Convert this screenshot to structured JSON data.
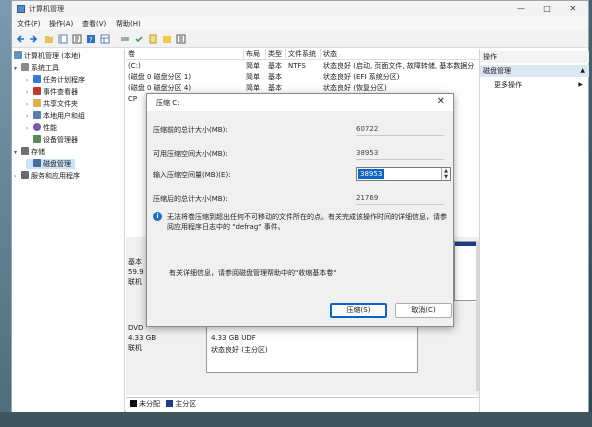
{
  "window": {
    "title": "计算机管理",
    "min": "—",
    "max": "□",
    "close": "✕"
  },
  "menu": [
    "文件(F)",
    "操作(A)",
    "查看(V)",
    "帮助(H)"
  ],
  "tree": [
    {
      "label": "计算机管理 (本地)",
      "indent": 0,
      "arrow": "",
      "color": "#6a8fb8"
    },
    {
      "label": "系统工具",
      "indent": 1,
      "arrow": "▾",
      "color": "#8a8a8a"
    },
    {
      "label": "任务计划程序",
      "indent": 2,
      "arrow": "›",
      "color": "#3a7bd5"
    },
    {
      "label": "事件查看器",
      "indent": 2,
      "arrow": "›",
      "color": "#c0392b"
    },
    {
      "label": "共享文件夹",
      "indent": 2,
      "arrow": "›",
      "color": "#e0b050"
    },
    {
      "label": "本地用户和组",
      "indent": 2,
      "arrow": "›",
      "color": "#5a7fa8"
    },
    {
      "label": "性能",
      "indent": 2,
      "arrow": "›",
      "color": "#7a5aa8"
    },
    {
      "label": "设备管理器",
      "indent": 2,
      "arrow": "",
      "color": "#5a8a5a"
    },
    {
      "label": "存储",
      "indent": 1,
      "arrow": "▾",
      "color": "#707070"
    },
    {
      "label": "磁盘管理",
      "indent": 2,
      "arrow": "",
      "color": "#4a6a9a",
      "selected": true
    },
    {
      "label": "服务和应用程序",
      "indent": 1,
      "arrow": "›",
      "color": "#6a6a6a"
    }
  ],
  "columns": [
    "卷",
    "布局",
    "类型",
    "文件系统",
    "状态"
  ],
  "volumes": [
    {
      "vol": "(C:)",
      "layout": "简单",
      "type": "基本",
      "fs": "NTFS",
      "status": "状态良好 (启动, 页面文件, 故障转储, 基本数据分"
    },
    {
      "vol": "(磁盘 0 磁盘分区 1)",
      "layout": "简单",
      "type": "基本",
      "fs": "",
      "status": "状态良好 (EFI 系统分区)"
    },
    {
      "vol": "(磁盘 0 磁盘分区 4)",
      "layout": "简单",
      "type": "基本",
      "fs": "",
      "status": "状态良好 (恢复分区)"
    },
    {
      "vol": "CP",
      "layout": "",
      "type": "",
      "fs": "",
      "status": ""
    }
  ],
  "lower": {
    "disk0": {
      "l1": "基本",
      "l2": "59.9",
      "l3": "联机"
    },
    "dvd": {
      "l1": "DVD",
      "l2": "4.33 GB",
      "l3": "联机"
    },
    "dvd_part": {
      "size": "4.33 GB UDF",
      "status": "状态良好 (主分区)"
    }
  },
  "legend": {
    "unalloc": "未分配",
    "primary": "主分区"
  },
  "actions": {
    "header": "操作",
    "section": "磁盘管理",
    "more": "更多操作"
  },
  "dialog": {
    "title": "压缩 C:",
    "close": "✕",
    "total_label": "压缩前的总计大小(MB):",
    "total_value": "60722",
    "avail_label": "可用压缩空间大小(MB):",
    "avail_value": "38953",
    "input_label": "输入压缩空间量(MB)(E):",
    "input_value": "38953",
    "after_label": "压缩后的总计大小(MB):",
    "after_value": "21769",
    "info_text": "无法将卷压缩到超出任何不可移动的文件所在的点。有关完成该操作时间的详细信息，请参阅应用程序日志中的 \"defrag\" 事件。",
    "more_text": "有关详细信息，请参阅磁盘管理帮助中的\"收缩基本卷\"",
    "ok": "压缩(S)",
    "cancel": "取消(C)"
  },
  "colors": {
    "accent": "#0a64c8",
    "primary_part": "#213a8a",
    "selected_bg": "#cce4f7"
  }
}
